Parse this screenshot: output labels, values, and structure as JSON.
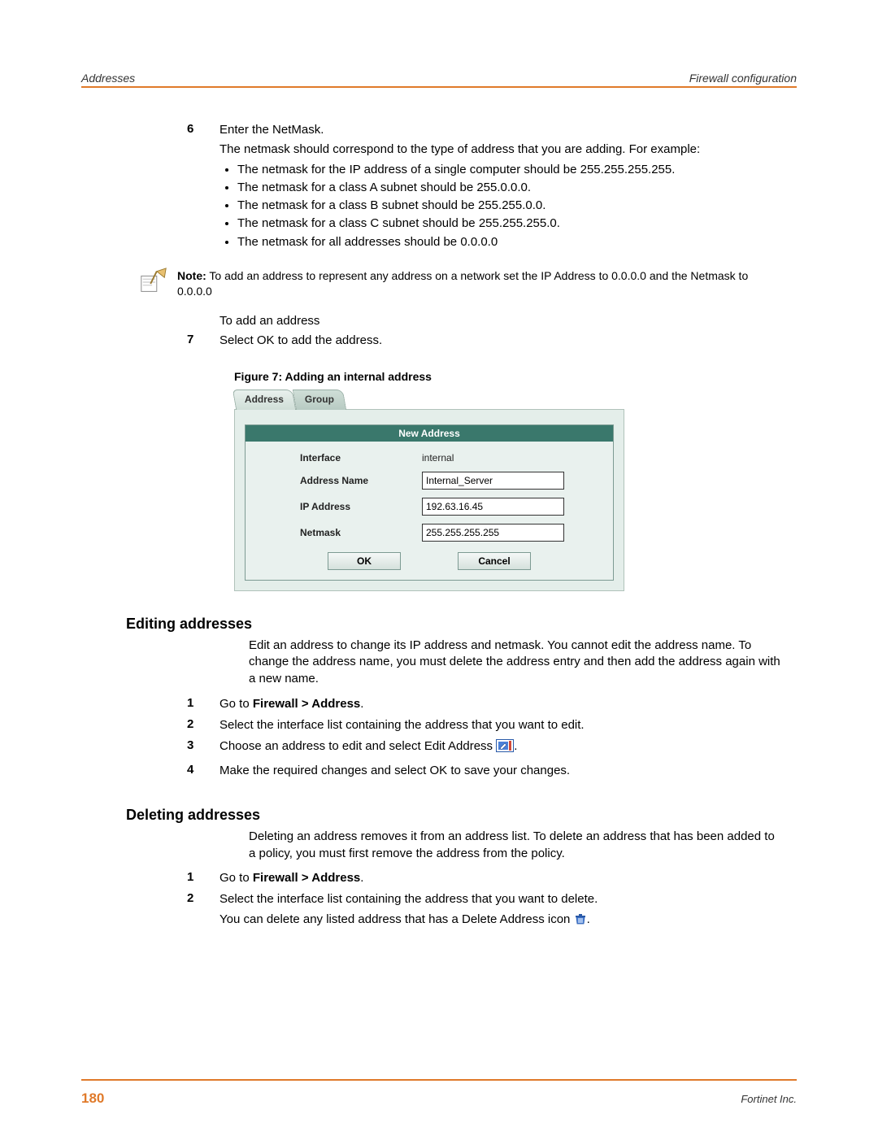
{
  "header": {
    "left": "Addresses",
    "right": "Firewall configuration"
  },
  "step6": {
    "num": "6",
    "title": "Enter the NetMask.",
    "para": "The netmask should correspond to the type of address that you are adding. For example:",
    "bullets": [
      "The netmask for the IP address of a single computer should be 255.255.255.255.",
      "The netmask for a class A subnet should be 255.0.0.0.",
      "The netmask for a class B subnet should be 255.255.0.0.",
      "The netmask for a class C subnet should be 255.255.255.0.",
      "The netmask for all addresses should be 0.0.0.0"
    ]
  },
  "note": {
    "label": "Note:",
    "text": " To add an address to represent any address on a network set the IP Address to 0.0.0.0 and the Netmask to 0.0.0.0"
  },
  "pre7": "To add an address",
  "step7": {
    "num": "7",
    "text": "Select OK to add the address."
  },
  "figcap": "Figure 7:   Adding an internal address",
  "figure": {
    "tab_address": "Address",
    "tab_group": "Group",
    "form_title": "New Address",
    "interface_label": "Interface",
    "interface_value": "internal",
    "name_label": "Address Name",
    "name_value": "Internal_Server",
    "ip_label": "IP Address",
    "ip_value": "192.63.16.45",
    "mask_label": "Netmask",
    "mask_value": "255.255.255.255",
    "ok": "OK",
    "cancel": "Cancel"
  },
  "edit": {
    "heading": "Editing addresses",
    "para": "Edit an address to change its IP address and netmask. You cannot edit the address name. To change the address name, you must delete the address entry and then add the address again with a new name.",
    "s1n": "1",
    "s1a": "Go to ",
    "s1b": "Firewall > Address",
    "s1c": ".",
    "s2n": "2",
    "s2": "Select the interface list containing the address that you want to edit.",
    "s3n": "3",
    "s3a": "Choose an address to edit and select Edit Address ",
    "s3b": ".",
    "s4n": "4",
    "s4": "Make the required changes and select OK to save your changes."
  },
  "del": {
    "heading": "Deleting addresses",
    "para": "Deleting an address removes it from an address list. To delete an address that has been added to a policy, you must first remove the address from the policy.",
    "s1n": "1",
    "s1a": "Go to ",
    "s1b": "Firewall > Address",
    "s1c": ".",
    "s2n": "2",
    "s2a": "Select the interface list containing the address that you want to delete.",
    "s2b": "You can delete any listed address that has a Delete Address icon ",
    "s2c": "."
  },
  "footer": {
    "page": "180",
    "company": "Fortinet Inc."
  }
}
